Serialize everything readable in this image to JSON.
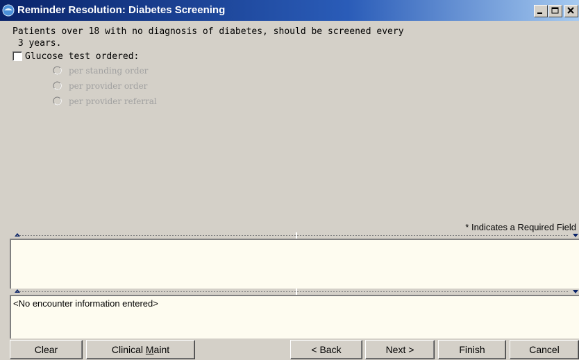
{
  "window": {
    "title": "Reminder Resolution: Diabetes Screening",
    "controls": [
      "minimize-icon",
      "maximize-icon",
      "close-icon"
    ],
    "accent_color": "#0a246a"
  },
  "reminder": {
    "description_line1": "Patients over 18 with no diagnosis of diabetes, should be screened every",
    "description_line2": " 3 years.",
    "checkbox_label": "Glucose test ordered:",
    "checkbox_checked": false,
    "radio_options": [
      {
        "label": "per standing order",
        "enabled": false
      },
      {
        "label": "per provider order",
        "enabled": false
      },
      {
        "label": "per provider referral",
        "enabled": false
      }
    ],
    "required_note": "* Indicates a Required Field"
  },
  "panels": {
    "progress_note_text": "",
    "encounter_text": "<No encounter information entered>",
    "background_color": "#fefcf0"
  },
  "buttons": {
    "clear": "Clear",
    "clinical_maint_prefix": "Clinical ",
    "clinical_maint_underline": "M",
    "clinical_maint_suffix": "aint",
    "back": "< Back",
    "next": "Next >",
    "finish": "Finish",
    "cancel": "Cancel"
  }
}
